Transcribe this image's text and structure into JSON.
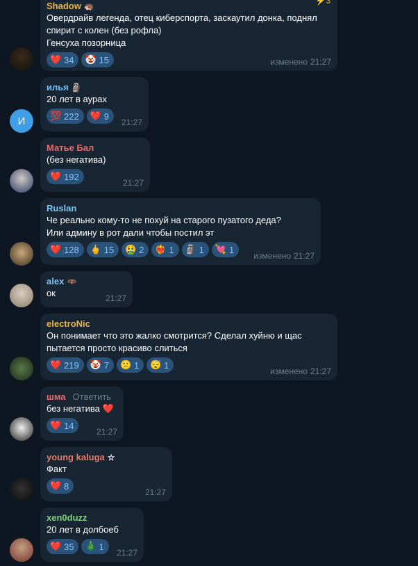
{
  "messages": [
    {
      "name": "Shadow",
      "name_color": "#e5b54a",
      "text": "Овердрайв легенда, отец киберспорта, заскаутил донка, поднял\nспирит с колен (без рофла)\nГенсуха позорница",
      "reactions": [
        {
          "emoji": "❤️",
          "count": "34"
        },
        {
          "emoji": "🤡",
          "count": "15"
        }
      ],
      "edited": "изменено",
      "time": "21:27",
      "corner_count": "3"
    },
    {
      "name": "илья",
      "name_color": "#72c0f5",
      "avatar_letter": "И",
      "text": "20 лет в аурах",
      "reactions": [
        {
          "emoji": "💯",
          "count": "222"
        },
        {
          "emoji": "❤️",
          "count": "9"
        }
      ],
      "time": "21:27"
    },
    {
      "name": "Матье Бал",
      "name_color": "#e56a6a",
      "text": "(без негатива)",
      "reactions": [
        {
          "emoji": "❤️",
          "count": "192"
        }
      ],
      "time": "21:27"
    },
    {
      "name": "Ruslan",
      "name_color": "#7ec4f2",
      "text": "Че реально кому-то не похуй на старого пузатого деда?\nИли админу в рот дали чтобы постил эт",
      "reactions": [
        {
          "emoji": "❤️",
          "count": "128"
        },
        {
          "emoji": "🖕",
          "count": "15"
        },
        {
          "emoji": "🤮",
          "count": "2"
        },
        {
          "emoji": "❤️‍🔥",
          "count": "1"
        },
        {
          "emoji": "🗿",
          "count": "1"
        },
        {
          "emoji": "💘",
          "count": "1"
        }
      ],
      "edited": "изменено",
      "time": "21:27"
    },
    {
      "name": "alex",
      "name_color": "#7ec4f2",
      "text": "ок",
      "reactions": [],
      "time": "21:27"
    },
    {
      "name": "electroNic",
      "name_color": "#e5b54a",
      "text": "Он понимает что это жалко смотрится? Сделал хуйню и щас\nпытается просто красиво слиться",
      "reactions": [
        {
          "emoji": "❤️",
          "count": "219"
        },
        {
          "emoji": "🤡",
          "count": "7"
        },
        {
          "emoji": "😕",
          "count": "1"
        },
        {
          "emoji": "😴",
          "count": "1"
        }
      ],
      "edited": "изменено",
      "time": "21:27"
    },
    {
      "name": "шма",
      "name_color": "#e56a6a",
      "reply": "Ответить",
      "text": "без негатива ❤️",
      "reactions": [
        {
          "emoji": "❤️",
          "count": "14"
        }
      ],
      "time": "21:27"
    },
    {
      "name": "young kaluga",
      "name_color": "#e57a6a",
      "text": "Факт",
      "reactions": [
        {
          "emoji": "❤️",
          "count": "8"
        }
      ],
      "time": "21:27"
    },
    {
      "name": "xen0duzz",
      "name_color": "#7ed07a",
      "text": "20 лет в долбоеб",
      "reactions": [
        {
          "emoji": "❤️",
          "count": "35"
        },
        {
          "emoji": "🎄",
          "count": "1"
        }
      ],
      "time": "21:27"
    }
  ]
}
